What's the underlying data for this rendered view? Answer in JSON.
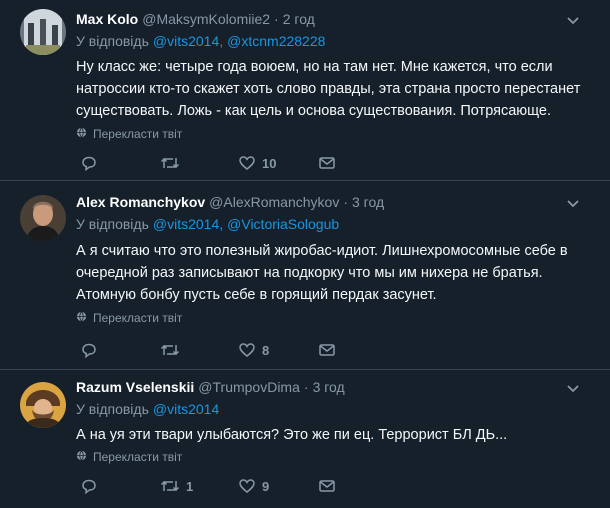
{
  "tweets": [
    {
      "name": "Max Kolo",
      "handle": "@MaksymKolomiie2",
      "dot": "·",
      "time": "2 год",
      "reply_prefix": "У відповідь",
      "reply_to": [
        "@vits2014",
        "@xtcnm228228"
      ],
      "text": "Ну класс же: четыре года воюем, но на там нет. Мне кажется, что если натроссии кто-то скажет хоть слово правды, эта страна просто перестанет существовать. Ложь - как цель и основа существования. Потрясающе.",
      "translate": "Перекласти твіт",
      "replies": "",
      "retweets": "",
      "likes": "10"
    },
    {
      "name": "Alex Romanchykov",
      "handle": "@AlexRomanchykov",
      "dot": "·",
      "time": "3 год",
      "reply_prefix": "У відповідь",
      "reply_to": [
        "@vits2014",
        "@VictoriaSologub"
      ],
      "text": "А я считаю что это полезный жиробас-идиот. Лишнехромосомные себе в очередной раз записывают на подкорку что мы им нихера не братья. Атомную бонбу пусть себе в горящий пердак засунет.",
      "translate": "Перекласти твіт",
      "replies": "",
      "retweets": "",
      "likes": "8"
    },
    {
      "name": "Razum Vselenskii",
      "handle": "@TrumpovDima",
      "dot": "·",
      "time": "3 год",
      "reply_prefix": "У відповідь",
      "reply_to": [
        "@vits2014"
      ],
      "text": "А на уя эти твари улыбаются?  Это же пи ец.  Террорист БЛ ДЬ...",
      "translate": "Перекласти твіт",
      "replies": "",
      "retweets": "1",
      "likes": "9"
    }
  ],
  "colors": {
    "background": "#15202b",
    "link": "#1b95e0",
    "muted": "#8899a6",
    "divider": "#38444d"
  },
  "icons": [
    "chevron-down-icon",
    "globe-icon",
    "reply-icon",
    "retweet-icon",
    "like-icon",
    "message-icon"
  ]
}
